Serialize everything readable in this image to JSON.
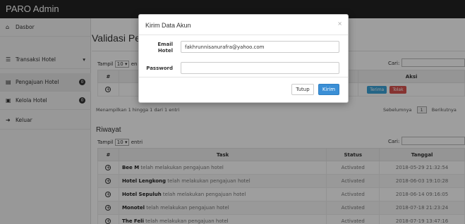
{
  "app": {
    "title": "PARO Admin"
  },
  "sidebar": {
    "items": [
      {
        "label": "Dasbor",
        "icon": "home-icon"
      },
      {
        "label": "Transaksi Hotel",
        "icon": "transaction-icon",
        "tail": "▾"
      },
      {
        "label": "Pengajuan Hotel",
        "icon": "submission-icon",
        "badge": "0"
      },
      {
        "label": "Kelola Hotel",
        "icon": "hotel-icon",
        "badge": "0"
      },
      {
        "label": "Keluar",
        "icon": "logout-icon"
      }
    ]
  },
  "main": {
    "page_title": "Validasi Pen",
    "top_table": {
      "show_prefix": "Tampil",
      "show_value": "10",
      "show_suffix": "en",
      "search_label": "Cari:",
      "headers": {
        "num": "#",
        "action": "Aksi"
      },
      "row": {
        "accept": "Terima",
        "reject": "Tolak"
      },
      "info": "Menampilkan 1 hingga 1 dari 1 entri",
      "prev": "Sebelumnya",
      "page": "1",
      "next": "Berikutnya"
    },
    "history": {
      "title": "Riwayat",
      "show_prefix": "Tampil",
      "show_value": "10",
      "show_suffix": "entri",
      "search_label": "Cari:",
      "headers": {
        "num": "#",
        "task": "Task",
        "status": "Status",
        "date": "Tanggal"
      },
      "rows": [
        {
          "name": "Bee M",
          "text": " telah melakukan pengajuan hotel",
          "status": "Activated",
          "date": "2018-05-29 21:32:54"
        },
        {
          "name": "Hotel Lengkong",
          "text": " telah melakukan pengajuan hotel",
          "status": "Activated",
          "date": "2018-06-03 19:10:28"
        },
        {
          "name": "Hotel Sepuluh",
          "text": " telah melakukan pengajuan hotel",
          "status": "Activated",
          "date": "2018-06-14 09:16:05"
        },
        {
          "name": "Monotel",
          "text": " telah melakukan pengajuan hotel",
          "status": "Activated",
          "date": "2018-07-18 21:23:24"
        },
        {
          "name": "The Feli",
          "text": " telah melakukan pengajuan hotel",
          "status": "Activated",
          "date": "2018-07-19 13:47:16"
        }
      ]
    }
  },
  "modal": {
    "title": "Kirim Data Akun",
    "close_glyph": "×",
    "email_label_1": "Email",
    "email_label_2": "Hotel",
    "email_value": "fakhrunnisanurafra@yahoo.com",
    "password_label": "Password",
    "password_value": "",
    "btn_close": "Tutup",
    "btn_send": "Kirim"
  },
  "colors": {
    "topbar": "#222222",
    "accept": "#3ba3d9",
    "reject": "#d9534f",
    "send": "#3b8fd6"
  }
}
